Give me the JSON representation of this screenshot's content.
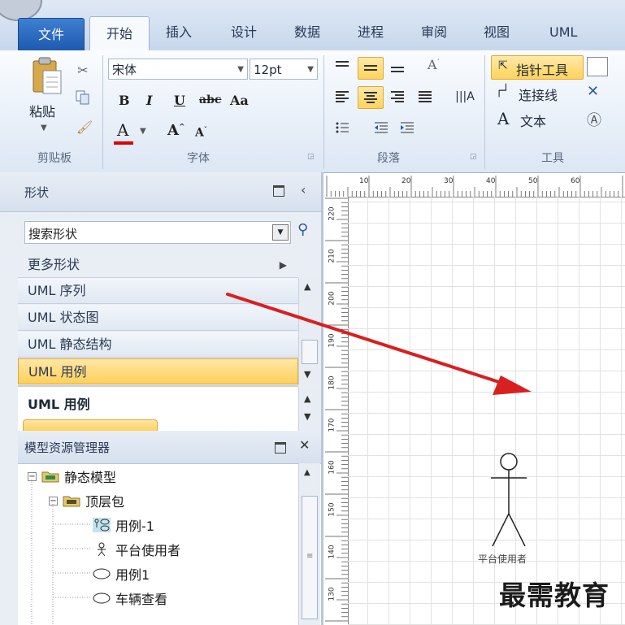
{
  "ribbon_tabs": {
    "file": "文件",
    "home": "开始",
    "insert": "插入",
    "design": "设计",
    "data": "数据",
    "process": "进程",
    "review": "审阅",
    "view": "视图",
    "uml": "UML"
  },
  "clipboard": {
    "paste_label": "粘贴",
    "group_label": "剪贴板"
  },
  "font": {
    "name_value": "宋体",
    "size_value": "12pt",
    "group_label": "字体"
  },
  "paragraph": {
    "group_label": "段落"
  },
  "tools": {
    "pointer_label": "指针工具",
    "connector_label": "连接线",
    "text_label": "文本",
    "group_label": "工具"
  },
  "shapes_panel": {
    "title": "形状",
    "search_placeholder": "搜索形状",
    "more_shapes": "更多形状",
    "stencils": [
      "UML 序列",
      "UML 状态图",
      "UML 静态结构",
      "UML 用例"
    ],
    "selected_stencil": "UML 用例",
    "open_stencil_title": "UML 用例"
  },
  "model_explorer": {
    "title": "模型资源管理器",
    "items": [
      {
        "label": "静态模型",
        "icon": "folder-icon"
      },
      {
        "label": "顶层包",
        "icon": "folder-icon"
      },
      {
        "label": "用例-1",
        "icon": "usecase-diagram-icon"
      },
      {
        "label": "平台使用者",
        "icon": "actor-icon"
      },
      {
        "label": "用例1",
        "icon": "ellipse-icon"
      },
      {
        "label": "车辆查看",
        "icon": "ellipse-icon"
      }
    ]
  },
  "canvas": {
    "h_ruler_ticks": [
      "10",
      "20",
      "30",
      "40",
      "50",
      "60"
    ],
    "v_ruler_ticks": [
      "220",
      "210",
      "200",
      "190",
      "180",
      "170",
      "160",
      "150",
      "140",
      "130"
    ],
    "actor_label": "平台使用者"
  },
  "watermark": "最需教育",
  "colors": {
    "file_tab": "#2a6ac0",
    "selected_button": "#ffd35a",
    "annotation_arrow": "#d91f1f"
  }
}
